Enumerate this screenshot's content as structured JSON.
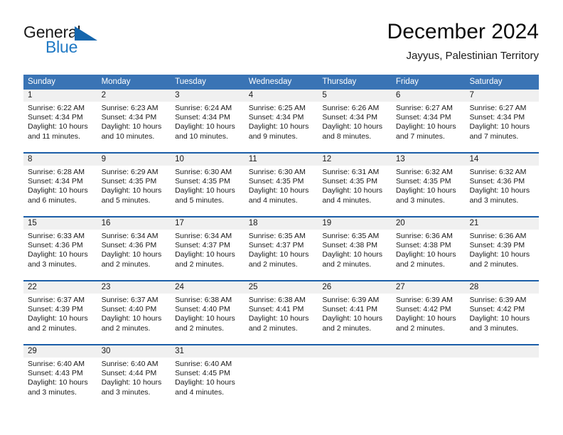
{
  "brand": {
    "name_part1": "General",
    "name_part2": "Blue",
    "mark": "triangle-flag-logo",
    "accent_color": "#2079c4"
  },
  "header": {
    "title": "December 2024",
    "subtitle": "Jayyus, Palestinian Territory"
  },
  "theme": {
    "header_bar_color": "#3a74b5",
    "row_divider_color": "#1c5ea8",
    "day_number_band_color": "#f0f0f0"
  },
  "calendar": {
    "weekdays": [
      "Sunday",
      "Monday",
      "Tuesday",
      "Wednesday",
      "Thursday",
      "Friday",
      "Saturday"
    ],
    "weeks": [
      [
        {
          "day": "1",
          "lines": [
            "Sunrise: 6:22 AM",
            "Sunset: 4:34 PM",
            "Daylight: 10 hours",
            "and 11 minutes."
          ]
        },
        {
          "day": "2",
          "lines": [
            "Sunrise: 6:23 AM",
            "Sunset: 4:34 PM",
            "Daylight: 10 hours",
            "and 10 minutes."
          ]
        },
        {
          "day": "3",
          "lines": [
            "Sunrise: 6:24 AM",
            "Sunset: 4:34 PM",
            "Daylight: 10 hours",
            "and 10 minutes."
          ]
        },
        {
          "day": "4",
          "lines": [
            "Sunrise: 6:25 AM",
            "Sunset: 4:34 PM",
            "Daylight: 10 hours",
            "and 9 minutes."
          ]
        },
        {
          "day": "5",
          "lines": [
            "Sunrise: 6:26 AM",
            "Sunset: 4:34 PM",
            "Daylight: 10 hours",
            "and 8 minutes."
          ]
        },
        {
          "day": "6",
          "lines": [
            "Sunrise: 6:27 AM",
            "Sunset: 4:34 PM",
            "Daylight: 10 hours",
            "and 7 minutes."
          ]
        },
        {
          "day": "7",
          "lines": [
            "Sunrise: 6:27 AM",
            "Sunset: 4:34 PM",
            "Daylight: 10 hours",
            "and 7 minutes."
          ]
        }
      ],
      [
        {
          "day": "8",
          "lines": [
            "Sunrise: 6:28 AM",
            "Sunset: 4:34 PM",
            "Daylight: 10 hours",
            "and 6 minutes."
          ]
        },
        {
          "day": "9",
          "lines": [
            "Sunrise: 6:29 AM",
            "Sunset: 4:35 PM",
            "Daylight: 10 hours",
            "and 5 minutes."
          ]
        },
        {
          "day": "10",
          "lines": [
            "Sunrise: 6:30 AM",
            "Sunset: 4:35 PM",
            "Daylight: 10 hours",
            "and 5 minutes."
          ]
        },
        {
          "day": "11",
          "lines": [
            "Sunrise: 6:30 AM",
            "Sunset: 4:35 PM",
            "Daylight: 10 hours",
            "and 4 minutes."
          ]
        },
        {
          "day": "12",
          "lines": [
            "Sunrise: 6:31 AM",
            "Sunset: 4:35 PM",
            "Daylight: 10 hours",
            "and 4 minutes."
          ]
        },
        {
          "day": "13",
          "lines": [
            "Sunrise: 6:32 AM",
            "Sunset: 4:35 PM",
            "Daylight: 10 hours",
            "and 3 minutes."
          ]
        },
        {
          "day": "14",
          "lines": [
            "Sunrise: 6:32 AM",
            "Sunset: 4:36 PM",
            "Daylight: 10 hours",
            "and 3 minutes."
          ]
        }
      ],
      [
        {
          "day": "15",
          "lines": [
            "Sunrise: 6:33 AM",
            "Sunset: 4:36 PM",
            "Daylight: 10 hours",
            "and 3 minutes."
          ]
        },
        {
          "day": "16",
          "lines": [
            "Sunrise: 6:34 AM",
            "Sunset: 4:36 PM",
            "Daylight: 10 hours",
            "and 2 minutes."
          ]
        },
        {
          "day": "17",
          "lines": [
            "Sunrise: 6:34 AM",
            "Sunset: 4:37 PM",
            "Daylight: 10 hours",
            "and 2 minutes."
          ]
        },
        {
          "day": "18",
          "lines": [
            "Sunrise: 6:35 AM",
            "Sunset: 4:37 PM",
            "Daylight: 10 hours",
            "and 2 minutes."
          ]
        },
        {
          "day": "19",
          "lines": [
            "Sunrise: 6:35 AM",
            "Sunset: 4:38 PM",
            "Daylight: 10 hours",
            "and 2 minutes."
          ]
        },
        {
          "day": "20",
          "lines": [
            "Sunrise: 6:36 AM",
            "Sunset: 4:38 PM",
            "Daylight: 10 hours",
            "and 2 minutes."
          ]
        },
        {
          "day": "21",
          "lines": [
            "Sunrise: 6:36 AM",
            "Sunset: 4:39 PM",
            "Daylight: 10 hours",
            "and 2 minutes."
          ]
        }
      ],
      [
        {
          "day": "22",
          "lines": [
            "Sunrise: 6:37 AM",
            "Sunset: 4:39 PM",
            "Daylight: 10 hours",
            "and 2 minutes."
          ]
        },
        {
          "day": "23",
          "lines": [
            "Sunrise: 6:37 AM",
            "Sunset: 4:40 PM",
            "Daylight: 10 hours",
            "and 2 minutes."
          ]
        },
        {
          "day": "24",
          "lines": [
            "Sunrise: 6:38 AM",
            "Sunset: 4:40 PM",
            "Daylight: 10 hours",
            "and 2 minutes."
          ]
        },
        {
          "day": "25",
          "lines": [
            "Sunrise: 6:38 AM",
            "Sunset: 4:41 PM",
            "Daylight: 10 hours",
            "and 2 minutes."
          ]
        },
        {
          "day": "26",
          "lines": [
            "Sunrise: 6:39 AM",
            "Sunset: 4:41 PM",
            "Daylight: 10 hours",
            "and 2 minutes."
          ]
        },
        {
          "day": "27",
          "lines": [
            "Sunrise: 6:39 AM",
            "Sunset: 4:42 PM",
            "Daylight: 10 hours",
            "and 2 minutes."
          ]
        },
        {
          "day": "28",
          "lines": [
            "Sunrise: 6:39 AM",
            "Sunset: 4:42 PM",
            "Daylight: 10 hours",
            "and 3 minutes."
          ]
        }
      ],
      [
        {
          "day": "29",
          "lines": [
            "Sunrise: 6:40 AM",
            "Sunset: 4:43 PM",
            "Daylight: 10 hours",
            "and 3 minutes."
          ]
        },
        {
          "day": "30",
          "lines": [
            "Sunrise: 6:40 AM",
            "Sunset: 4:44 PM",
            "Daylight: 10 hours",
            "and 3 minutes."
          ]
        },
        {
          "day": "31",
          "lines": [
            "Sunrise: 6:40 AM",
            "Sunset: 4:45 PM",
            "Daylight: 10 hours",
            "and 4 minutes."
          ]
        },
        {
          "day": "",
          "lines": []
        },
        {
          "day": "",
          "lines": []
        },
        {
          "day": "",
          "lines": []
        },
        {
          "day": "",
          "lines": []
        }
      ]
    ]
  }
}
